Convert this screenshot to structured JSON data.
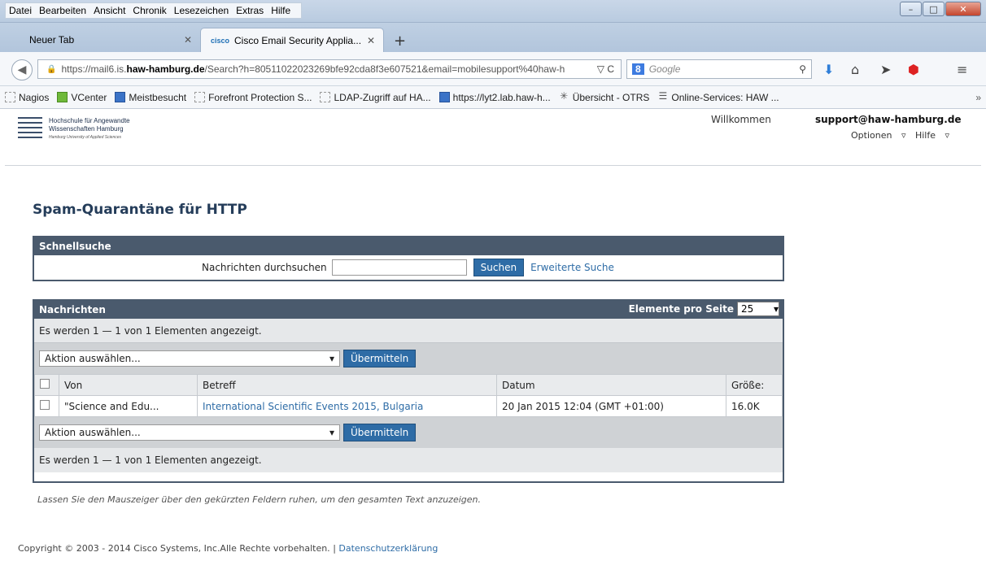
{
  "menubar": [
    "Datei",
    "Bearbeiten",
    "Ansicht",
    "Chronik",
    "Lesezeichen",
    "Extras",
    "Hilfe"
  ],
  "tabs": {
    "inactive_label": "Neuer Tab",
    "active_label": "Cisco Email Security Applia...",
    "active_favicon": "cisco"
  },
  "nav": {
    "url_prefix": "https://mail6.is.",
    "url_domain": "haw-hamburg.de",
    "url_rest": "/Search?h=80511022023269bfe92cda8f3e607521&email=mobilesupport%40haw-h",
    "search_placeholder": "Google",
    "search_engine": "8"
  },
  "bookmarks": [
    {
      "label": "Nagios",
      "icon": "page-icon"
    },
    {
      "label": "VCenter",
      "icon": "vcenter-icon"
    },
    {
      "label": "Meistbesucht",
      "icon": "meistbesucht-icon"
    },
    {
      "label": "Forefront Protection S...",
      "icon": "page-icon"
    },
    {
      "label": "LDAP-Zugriff auf HA...",
      "icon": "page-icon"
    },
    {
      "label": "https://lyt2.lab.haw-h...",
      "icon": "outlook-icon"
    },
    {
      "label": "Übersicht - OTRS",
      "icon": "otrs-icon"
    },
    {
      "label": "Online-Services: HAW ...",
      "icon": "list-icon"
    }
  ],
  "header": {
    "logo_line1": "Hochschule für Angewandte",
    "logo_line2": "Wissenschaften Hamburg",
    "logo_line3": "Hamburg University of Applied Sciences",
    "welcome": "Willkommen",
    "user": "support@haw-hamburg.de",
    "options": "Optionen",
    "help": "Hilfe"
  },
  "page_title": "Spam-Quarantäne für HTTP",
  "quicksearch": {
    "title": "Schnellsuche",
    "label": "Nachrichten durchsuchen",
    "input_value": "",
    "button": "Suchen",
    "advanced_link": "Erweiterte Suche"
  },
  "messages": {
    "title": "Nachrichten",
    "per_page_label": "Elemente pro Seite",
    "per_page_value": "25",
    "info_top": "Es werden 1 — 1 von 1 Elementen angezeigt.",
    "info_bottom": "Es werden 1 — 1 von 1 Elementen angezeigt.",
    "action_placeholder": "Aktion auswählen...",
    "submit": "Übermitteln",
    "columns": [
      "Von",
      "Betreff",
      "Datum",
      "Größe:"
    ],
    "rows": [
      {
        "from": "\"Science and Edu...",
        "subject": "International Scientific Events 2015, Bulgaria",
        "date": "20 Jan 2015 12:04 (GMT +01:00)",
        "size": "16.0K"
      }
    ]
  },
  "hint": "Lassen Sie den Mauszeiger über den gekürzten Feldern ruhen, um den gesamten Text anzuzeigen.",
  "footer": {
    "copyright": "Copyright © 2003 - 2014 Cisco Systems, Inc.Alle Rechte vorbehalten.",
    "sep": "|",
    "privacy": "Datenschutzerklärung"
  }
}
